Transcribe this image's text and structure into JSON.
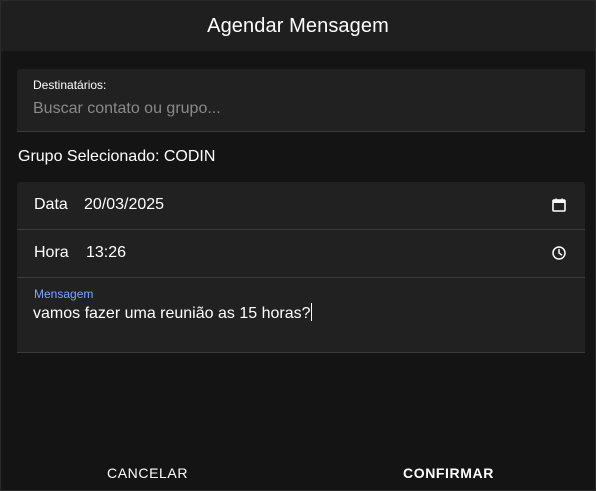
{
  "dialog": {
    "title": "Agendar Mensagem"
  },
  "recipients": {
    "label": "Destinatários:",
    "placeholder": "Buscar contato ou grupo...",
    "value": ""
  },
  "selected_group": {
    "text": "Grupo Selecionado: CODIN"
  },
  "date_row": {
    "label": "Data",
    "value": "20/03/2025",
    "icon": "calendar-icon"
  },
  "time_row": {
    "label": "Hora",
    "value": "13:26",
    "icon": "clock-icon"
  },
  "message": {
    "label": "Mensagem",
    "value": "vamos fazer uma reunião as 15 horas?",
    "label_color": "#7ea6ff"
  },
  "actions": {
    "cancel_label": "CANCELAR",
    "confirm_label": "CONFIRMAR"
  }
}
